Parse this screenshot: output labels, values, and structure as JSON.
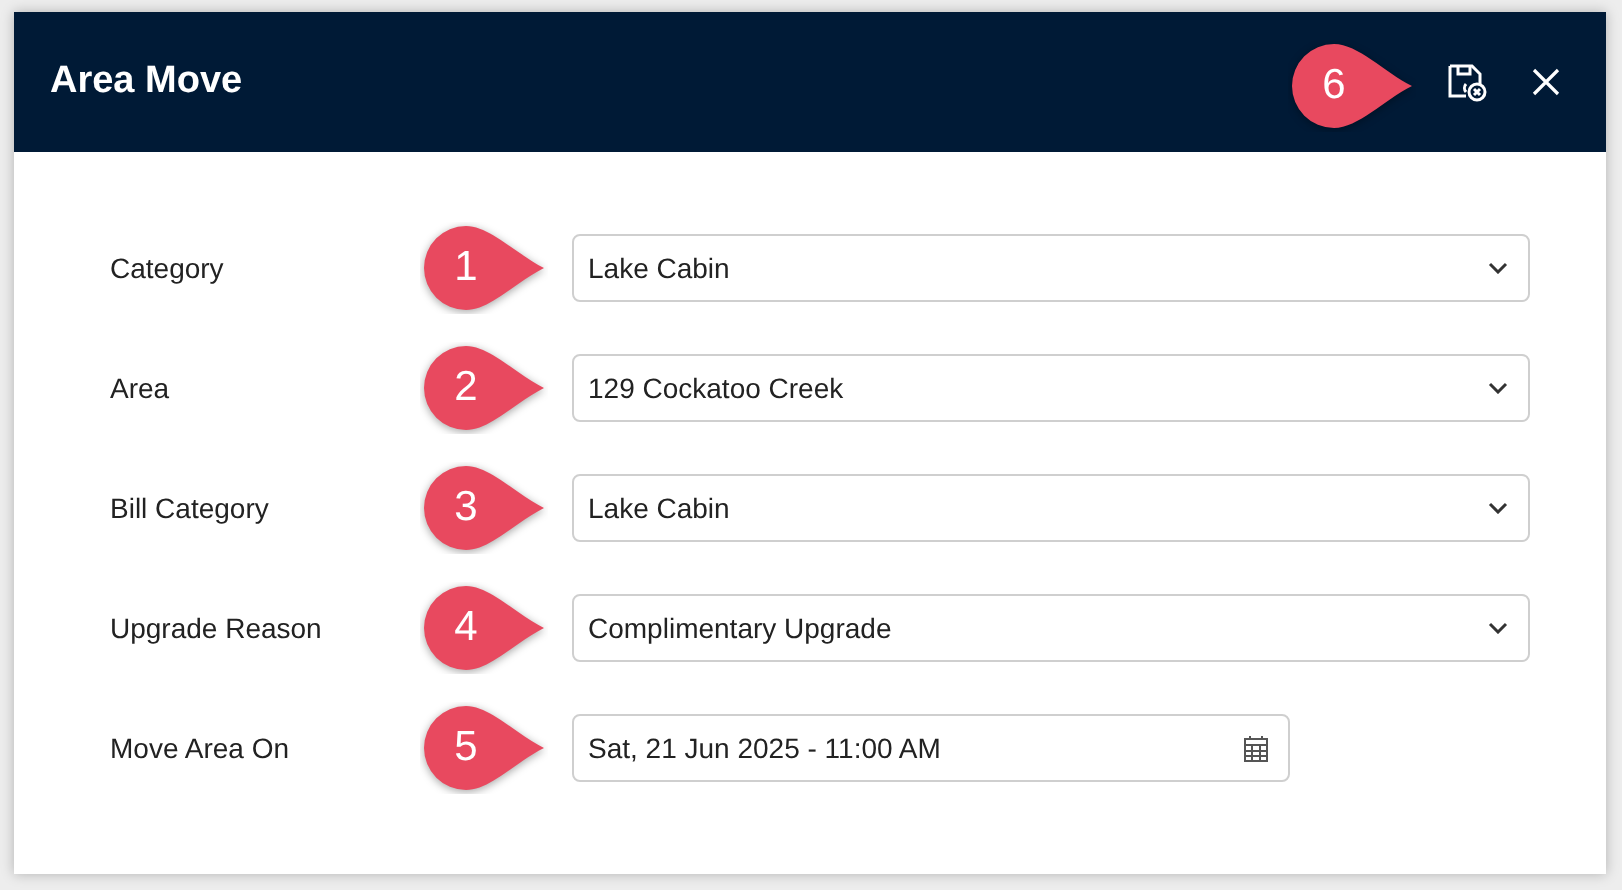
{
  "window": {
    "title": "Area Move",
    "header_marker": "6"
  },
  "fields": [
    {
      "label": "Category",
      "kind": "select",
      "value": "Lake Cabin",
      "marker": "1"
    },
    {
      "label": "Area",
      "kind": "select",
      "value": "129 Cockatoo Creek",
      "marker": "2"
    },
    {
      "label": "Bill Category",
      "kind": "select",
      "value": "Lake Cabin",
      "marker": "3"
    },
    {
      "label": "Upgrade Reason",
      "kind": "select",
      "value": "Complimentary Upgrade",
      "marker": "4"
    },
    {
      "label": "Move Area On",
      "kind": "date",
      "value": "Sat, 21 Jun 2025 - 11:00 AM",
      "marker": "5"
    }
  ]
}
